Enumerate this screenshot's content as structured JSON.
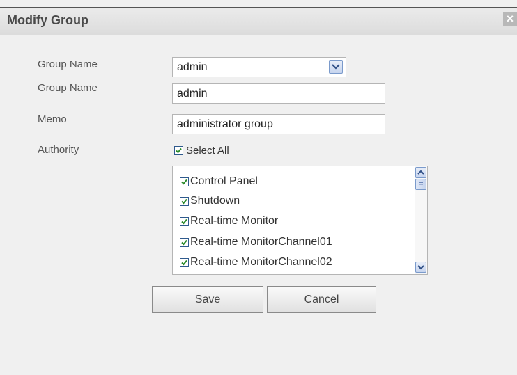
{
  "dialog": {
    "title": "Modify Group",
    "close_icon": "close-icon",
    "close_glyph": "×"
  },
  "form": {
    "group_select": {
      "label": "Group Name",
      "value": "admin"
    },
    "group_name": {
      "label": "Group Name",
      "value": "admin"
    },
    "memo": {
      "label": "Memo",
      "value": "administrator group"
    },
    "authority": {
      "label": "Authority",
      "select_all_label": "Select All",
      "select_all_checked": true,
      "items": [
        {
          "label": "Control Panel",
          "checked": true
        },
        {
          "label": "Shutdown",
          "checked": true
        },
        {
          "label": "Real-time Monitor",
          "checked": true
        },
        {
          "label": "Real-time MonitorChannel01",
          "checked": true
        },
        {
          "label": "Real-time MonitorChannel02",
          "checked": true
        }
      ]
    }
  },
  "buttons": {
    "save_label": "Save",
    "cancel_label": "Cancel"
  },
  "colors": {
    "check_mark": "#2a8a2a",
    "title_text": "#4a4a4a"
  }
}
